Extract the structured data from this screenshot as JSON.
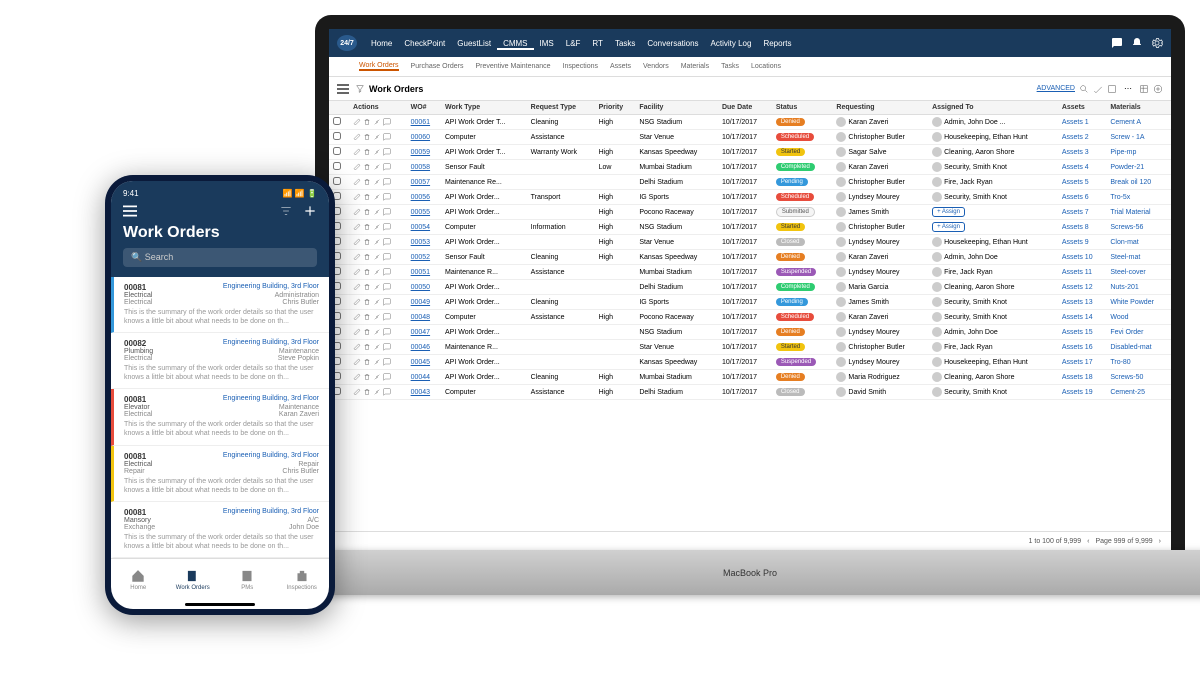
{
  "laptop": {
    "brand": "MacBook Pro",
    "logo": "24/7",
    "nav": [
      "Home",
      "CheckPoint",
      "GuestList",
      "CMMS",
      "IMS",
      "L&F",
      "RT",
      "Tasks",
      "Conversations",
      "Activity Log",
      "Reports"
    ],
    "nav_active": 3,
    "subnav": [
      "Work Orders",
      "Purchase Orders",
      "Preventive Maintenance",
      "Inspections",
      "Assets",
      "Vendors",
      "Materials",
      "Tasks",
      "Locations"
    ],
    "subnav_active": 0,
    "page_title": "Work Orders",
    "advanced": "ADVANCED",
    "columns": [
      "",
      "Actions",
      "WO#",
      "Work Type",
      "Request Type",
      "Priority",
      "Facility",
      "Due Date",
      "Status",
      "Requesting",
      "Assigned To",
      "Assets",
      "Materials"
    ],
    "rows": [
      {
        "wo": "00061",
        "wt": "API Work Order T...",
        "rt": "Cleaning",
        "pr": "High",
        "fac": "NSG Stadium",
        "dd": "10/17/2017",
        "st": "Denied",
        "sc": "s-denied",
        "req": "Karan Zaveri",
        "asg": "Admin, John Doe ...",
        "as": "Assets 1",
        "mat": "Cement A"
      },
      {
        "wo": "00060",
        "wt": "Computer",
        "rt": "Assistance",
        "pr": "",
        "fac": "Star Venue",
        "dd": "10/17/2017",
        "st": "Scheduled",
        "sc": "s-scheduled",
        "req": "Christopher Butler",
        "asg": "Housekeeping, Ethan Hunt",
        "as": "Assets 2",
        "mat": "Screw - 1A"
      },
      {
        "wo": "00059",
        "wt": "API Work Order T...",
        "rt": "Warranty Work",
        "pr": "High",
        "fac": "Kansas Speedway",
        "dd": "10/17/2017",
        "st": "Started",
        "sc": "s-started",
        "req": "Sagar Salve",
        "asg": "Cleaning, Aaron Shore",
        "as": "Assets 3",
        "mat": "Pipe-mp"
      },
      {
        "wo": "00058",
        "wt": "Sensor Fault",
        "rt": "",
        "pr": "Low",
        "fac": "Mumbai Stadium",
        "dd": "10/17/2017",
        "st": "Completed",
        "sc": "s-completed",
        "req": "Karan Zaveri",
        "asg": "Security, Smith Knot",
        "as": "Assets 4",
        "mat": "Powder-21"
      },
      {
        "wo": "00057",
        "wt": "Maintenance Re...",
        "rt": "",
        "pr": "",
        "fac": "Delhi Stadium",
        "dd": "10/17/2017",
        "st": "Pending",
        "sc": "s-pending",
        "req": "Christopher Butler",
        "asg": "Fire, Jack Ryan",
        "as": "Assets 5",
        "mat": "Break oil 120"
      },
      {
        "wo": "00056",
        "wt": "API Work Order...",
        "rt": "Transport",
        "pr": "High",
        "fac": "IG Sports",
        "dd": "10/17/2017",
        "st": "Scheduled",
        "sc": "s-scheduled",
        "req": "Lyndsey Mourey",
        "asg": "Security, Smith Knot",
        "as": "Assets 6",
        "mat": "Tro-5x"
      },
      {
        "wo": "00055",
        "wt": "API Work Order...",
        "rt": "",
        "pr": "High",
        "fac": "Pocono Raceway",
        "dd": "10/17/2017",
        "st": "Submitted",
        "sc": "s-submitted",
        "req": "James Smith",
        "asg": "+ Assign",
        "as": "Assets 7",
        "mat": "Trial Material"
      },
      {
        "wo": "00054",
        "wt": "Computer",
        "rt": "Information",
        "pr": "High",
        "fac": "NSG Stadium",
        "dd": "10/17/2017",
        "st": "Started",
        "sc": "s-started",
        "req": "Christopher Butler",
        "asg": "+ Assign",
        "as": "Assets 8",
        "mat": "Screws-56"
      },
      {
        "wo": "00053",
        "wt": "API Work Order...",
        "rt": "",
        "pr": "High",
        "fac": "Star Venue",
        "dd": "10/17/2017",
        "st": "Closed",
        "sc": "s-closed",
        "req": "Lyndsey Mourey",
        "asg": "Housekeeping, Ethan Hunt",
        "as": "Assets 9",
        "mat": "Clon-mat"
      },
      {
        "wo": "00052",
        "wt": "Sensor Fault",
        "rt": "Cleaning",
        "pr": "High",
        "fac": "Kansas Speedway",
        "dd": "10/17/2017",
        "st": "Denied",
        "sc": "s-denied",
        "req": "Karan Zaveri",
        "asg": "Admin, John Doe",
        "as": "Assets 10",
        "mat": "Steel-mat"
      },
      {
        "wo": "00051",
        "wt": "Maintenance R...",
        "rt": "Assistance",
        "pr": "",
        "fac": "Mumbai Stadium",
        "dd": "10/17/2017",
        "st": "Suspended",
        "sc": "s-suspended",
        "req": "Lyndsey Mourey",
        "asg": "Fire, Jack Ryan",
        "as": "Assets 11",
        "mat": "Steel-cover"
      },
      {
        "wo": "00050",
        "wt": "API Work Order...",
        "rt": "",
        "pr": "",
        "fac": "Delhi Stadium",
        "dd": "10/17/2017",
        "st": "Completed",
        "sc": "s-completed",
        "req": "Maria Garcia",
        "asg": "Cleaning, Aaron Shore",
        "as": "Assets 12",
        "mat": "Nuts-201"
      },
      {
        "wo": "00049",
        "wt": "API Work Order...",
        "rt": "Cleaning",
        "pr": "",
        "fac": "IG Sports",
        "dd": "10/17/2017",
        "st": "Pending",
        "sc": "s-pending",
        "req": "James Smith",
        "asg": "Security, Smith Knot",
        "as": "Assets 13",
        "mat": "White Powder"
      },
      {
        "wo": "00048",
        "wt": "Computer",
        "rt": "Assistance",
        "pr": "High",
        "fac": "Pocono Raceway",
        "dd": "10/17/2017",
        "st": "Scheduled",
        "sc": "s-scheduled",
        "req": "Karan Zaveri",
        "asg": "Security, Smith Knot",
        "as": "Assets 14",
        "mat": "Wood"
      },
      {
        "wo": "00047",
        "wt": "API Work Order...",
        "rt": "",
        "pr": "",
        "fac": "NSG Stadium",
        "dd": "10/17/2017",
        "st": "Denied",
        "sc": "s-denied",
        "req": "Lyndsey Mourey",
        "asg": "Admin, John Doe",
        "as": "Assets 15",
        "mat": "Fevi Order"
      },
      {
        "wo": "00046",
        "wt": "Maintenance R...",
        "rt": "",
        "pr": "",
        "fac": "Star Venue",
        "dd": "10/17/2017",
        "st": "Started",
        "sc": "s-started",
        "req": "Christopher Butler",
        "asg": "Fire, Jack Ryan",
        "as": "Assets 16",
        "mat": "Disabled-mat"
      },
      {
        "wo": "00045",
        "wt": "API Work Order...",
        "rt": "",
        "pr": "",
        "fac": "Kansas Speedway",
        "dd": "10/17/2017",
        "st": "Suspended",
        "sc": "s-suspended",
        "req": "Lyndsey Mourey",
        "asg": "Housekeeping, Ethan Hunt",
        "as": "Assets 17",
        "mat": "Tro-80"
      },
      {
        "wo": "00044",
        "wt": "API Work Order...",
        "rt": "Cleaning",
        "pr": "High",
        "fac": "Mumbai Stadium",
        "dd": "10/17/2017",
        "st": "Denied",
        "sc": "s-denied",
        "req": "Maria Rodriguez",
        "asg": "Cleaning, Aaron Shore",
        "as": "Assets 18",
        "mat": "Screws-50"
      },
      {
        "wo": "00043",
        "wt": "Computer",
        "rt": "Assistance",
        "pr": "High",
        "fac": "Delhi Stadium",
        "dd": "10/17/2017",
        "st": "Closed",
        "sc": "s-closed",
        "req": "David Smith",
        "asg": "Security, Smith Knot",
        "as": "Assets 19",
        "mat": "Cement-25"
      }
    ],
    "pager": {
      "range": "1 to 100 of 9,999",
      "page": "Page 999 of 9,999"
    },
    "chat": "Chat"
  },
  "phone": {
    "time": "9:41",
    "title": "Work Orders",
    "search_ph": "Search",
    "items": [
      {
        "id": "00081",
        "loc": "Engineering Building, 3rd Floor",
        "cat": "Electrical",
        "sub": "Administration",
        "who": "Chris Butler",
        "cls": "li-blue"
      },
      {
        "id": "00082",
        "loc": "Engineering Building, 3rd Floor",
        "cat": "Plumbing",
        "sub": "Maintenance",
        "who": "Steve Popkin",
        "cls": ""
      },
      {
        "id": "00081",
        "loc": "Engineering Building, 3rd Floor",
        "cat": "Elevator",
        "sub": "Maintenance",
        "who": "Karan Zaveri",
        "cls": "li-red"
      },
      {
        "id": "00081",
        "loc": "Engineering Building, 3rd Floor",
        "cat": "Electrical",
        "sub": "Repair",
        "who": "Chris Butler",
        "cls": "li-yellow"
      },
      {
        "id": "00081",
        "loc": "Engineering Building, 3rd Floor",
        "cat": "Mansory",
        "sub": "A/C",
        "who": "John Doe",
        "cls": ""
      }
    ],
    "desc": "This is the summary of the work order details so that the user knows a little bit about what needs to be done on th...",
    "tabs": [
      "Home",
      "Work Orders",
      "PMs",
      "Inspections"
    ],
    "tab_active": 1
  }
}
